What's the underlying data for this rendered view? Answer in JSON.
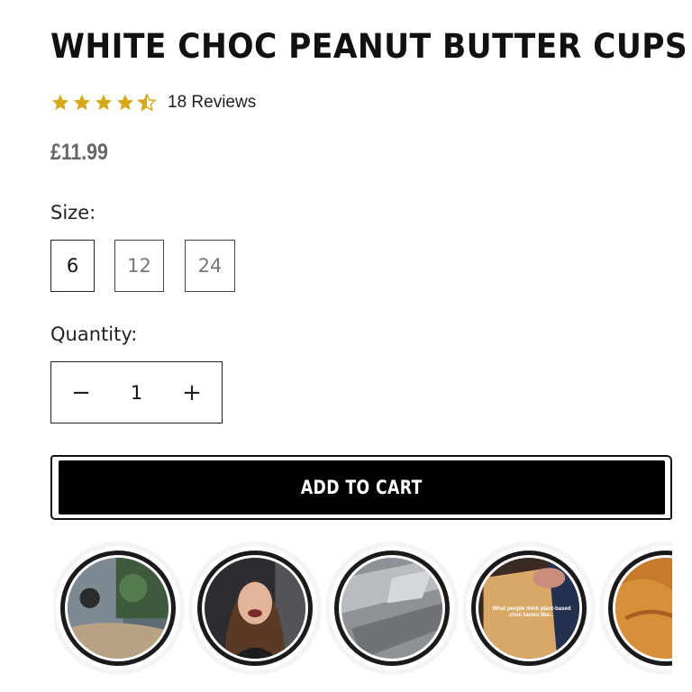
{
  "product": {
    "title": "WHITE CHOC PEANUT BUTTER CUPS",
    "rating": 4.5,
    "reviews_label": "18 Reviews",
    "price": "£11.99"
  },
  "size": {
    "label": "Size:",
    "options": [
      "6",
      "12",
      "24"
    ],
    "selected": "6"
  },
  "quantity": {
    "label": "Quantity:",
    "decrement_symbol": "−",
    "value": "1",
    "increment_symbol": "+"
  },
  "cart": {
    "label": "ADD TO CART"
  },
  "stories": {
    "items": [
      {
        "name": "story-1"
      },
      {
        "name": "story-2"
      },
      {
        "name": "story-3"
      },
      {
        "name": "story-4",
        "caption": "What people think plant-based choc tastes like..."
      },
      {
        "name": "story-5"
      }
    ]
  },
  "colors": {
    "star": "#d4aa1a",
    "button_bg": "#000000",
    "button_text": "#ffffff",
    "price": "#666666"
  }
}
